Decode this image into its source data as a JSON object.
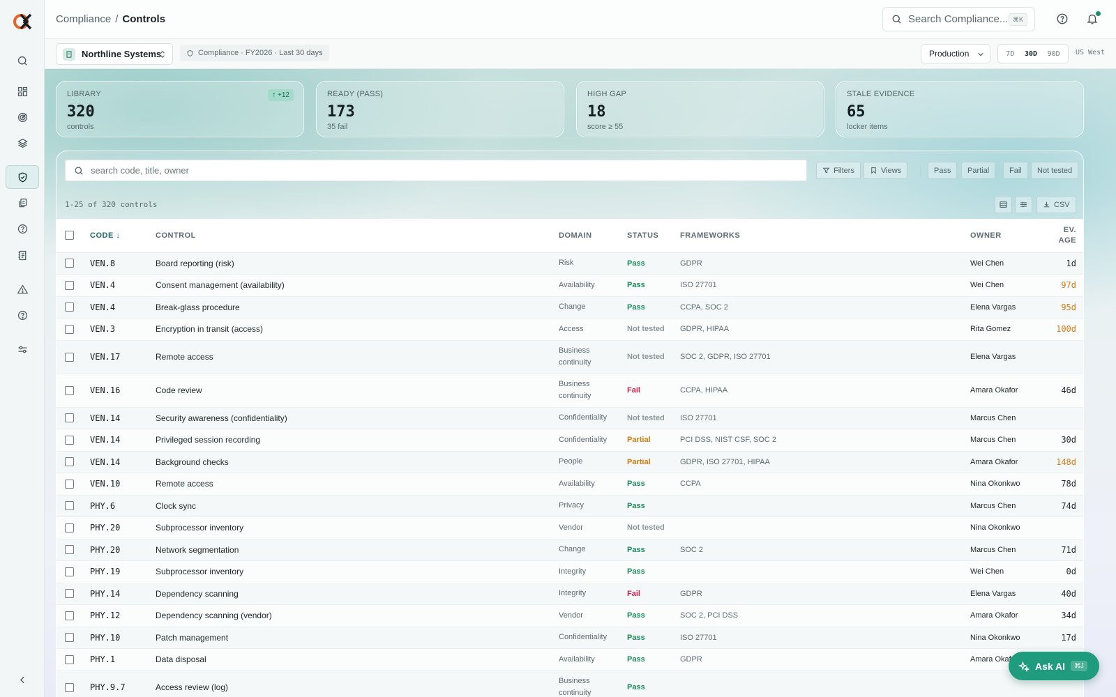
{
  "breadcrumb": {
    "parent": "Compliance",
    "separator": "/",
    "current": "Controls"
  },
  "global_search": {
    "placeholder": "Search Compliance...",
    "shortcut": "⌘K"
  },
  "context": {
    "org": "Northline Systems",
    "scope": "Compliance · FY2026 · Last 30 days",
    "environment": "Production",
    "ranges": [
      "7D",
      "30D",
      "90D"
    ],
    "selected_range": "30D",
    "region": "US West"
  },
  "stats": [
    {
      "label": "LIBRARY",
      "value": "320",
      "sub": "controls",
      "delta": "↑ +12"
    },
    {
      "label": "READY (PASS)",
      "value": "173",
      "sub": "35 fail"
    },
    {
      "label": "HIGH GAP",
      "value": "18",
      "sub": "score ≥ 55"
    },
    {
      "label": "STALE EVIDENCE",
      "value": "65",
      "sub": "locker items"
    }
  ],
  "toolbar": {
    "search_placeholder": "search code, title, owner",
    "filters": "Filters",
    "views": "Views",
    "status_filters": [
      "Pass",
      "Partial",
      "Fail",
      "Not tested"
    ],
    "count": "1-25 of 320 controls",
    "csv": "CSV"
  },
  "table": {
    "headers": {
      "code": "CODE ↓",
      "control": "CONTROL",
      "domain": "DOMAIN",
      "status": "STATUS",
      "frameworks": "FRAMEWORKS",
      "owner": "OWNER",
      "ev_age": "EV. AGE"
    },
    "rows": [
      {
        "code": "VEN.8",
        "control": "Board reporting (risk)",
        "domain": "Risk",
        "status": "Pass",
        "frameworks": "GDPR",
        "owner": "Wei Chen",
        "age": "1d",
        "stale": false
      },
      {
        "code": "VEN.4",
        "control": "Consent management (availability)",
        "domain": "Availability",
        "status": "Pass",
        "frameworks": "ISO 27701",
        "owner": "Wei Chen",
        "age": "97d",
        "stale": true
      },
      {
        "code": "VEN.4",
        "control": "Break-glass procedure",
        "domain": "Change",
        "status": "Pass",
        "frameworks": "CCPA, SOC 2",
        "owner": "Elena Vargas",
        "age": "95d",
        "stale": true
      },
      {
        "code": "VEN.3",
        "control": "Encryption in transit (access)",
        "domain": "Access",
        "status": "Not tested",
        "frameworks": "GDPR, HIPAA",
        "owner": "Rita Gomez",
        "age": "100d",
        "stale": true
      },
      {
        "code": "VEN.17",
        "control": "Remote access",
        "domain": "Business continuity",
        "status": "Not tested",
        "frameworks": "SOC 2, GDPR, ISO 27701",
        "owner": "Elena Vargas",
        "age": "",
        "stale": false
      },
      {
        "code": "VEN.16",
        "control": "Code review",
        "domain": "Business continuity",
        "status": "Fail",
        "frameworks": "CCPA, HIPAA",
        "owner": "Amara Okafor",
        "age": "46d",
        "stale": false
      },
      {
        "code": "VEN.14",
        "control": "Security awareness (confidentiality)",
        "domain": "Confidentiality",
        "status": "Not tested",
        "frameworks": "ISO 27701",
        "owner": "Marcus Chen",
        "age": "",
        "stale": false
      },
      {
        "code": "VEN.14",
        "control": "Privileged session recording",
        "domain": "Confidentiality",
        "status": "Partial",
        "frameworks": "PCI DSS, NIST CSF, SOC 2",
        "owner": "Marcus Chen",
        "age": "30d",
        "stale": false
      },
      {
        "code": "VEN.14",
        "control": "Background checks",
        "domain": "People",
        "status": "Partial",
        "frameworks": "GDPR, ISO 27701, HIPAA",
        "owner": "Amara Okafor",
        "age": "148d",
        "stale": true
      },
      {
        "code": "VEN.10",
        "control": "Remote access",
        "domain": "Availability",
        "status": "Pass",
        "frameworks": "CCPA",
        "owner": "Nina Okonkwo",
        "age": "78d",
        "stale": false
      },
      {
        "code": "PHY.6",
        "control": "Clock sync",
        "domain": "Privacy",
        "status": "Pass",
        "frameworks": "",
        "owner": "Marcus Chen",
        "age": "74d",
        "stale": false
      },
      {
        "code": "PHY.20",
        "control": "Subprocessor inventory",
        "domain": "Vendor",
        "status": "Not tested",
        "frameworks": "",
        "owner": "Nina Okonkwo",
        "age": "",
        "stale": false
      },
      {
        "code": "PHY.20",
        "control": "Network segmentation",
        "domain": "Change",
        "status": "Pass",
        "frameworks": "SOC 2",
        "owner": "Marcus Chen",
        "age": "71d",
        "stale": false
      },
      {
        "code": "PHY.19",
        "control": "Subprocessor inventory",
        "domain": "Integrity",
        "status": "Pass",
        "frameworks": "",
        "owner": "Wei Chen",
        "age": "0d",
        "stale": false
      },
      {
        "code": "PHY.14",
        "control": "Dependency scanning",
        "domain": "Integrity",
        "status": "Fail",
        "frameworks": "GDPR",
        "owner": "Elena Vargas",
        "age": "40d",
        "stale": false
      },
      {
        "code": "PHY.12",
        "control": "Dependency scanning (vendor)",
        "domain": "Vendor",
        "status": "Pass",
        "frameworks": "SOC 2, PCI DSS",
        "owner": "Amara Okafor",
        "age": "34d",
        "stale": false
      },
      {
        "code": "PHY.10",
        "control": "Patch management",
        "domain": "Confidentiality",
        "status": "Pass",
        "frameworks": "ISO 27701",
        "owner": "Nina Okonkwo",
        "age": "17d",
        "stale": false
      },
      {
        "code": "PHY.1",
        "control": "Data disposal",
        "domain": "Availability",
        "status": "Pass",
        "frameworks": "GDPR",
        "owner": "Amara Okafor",
        "age": "",
        "stale": false
      },
      {
        "code": "PHY.9.7",
        "control": "Access review (log)",
        "domain": "Business continuity",
        "status": "Pass",
        "frameworks": "",
        "owner": "",
        "age": "",
        "stale": false
      }
    ]
  },
  "ask_ai": {
    "label": "Ask AI",
    "shortcut": "⌘J"
  },
  "colors": {
    "accent": "#1f9b7d",
    "pass": "#1b8a5a",
    "fail": "#d11f4a",
    "partial": "#d47a10",
    "not_tested": "#8a979b"
  }
}
